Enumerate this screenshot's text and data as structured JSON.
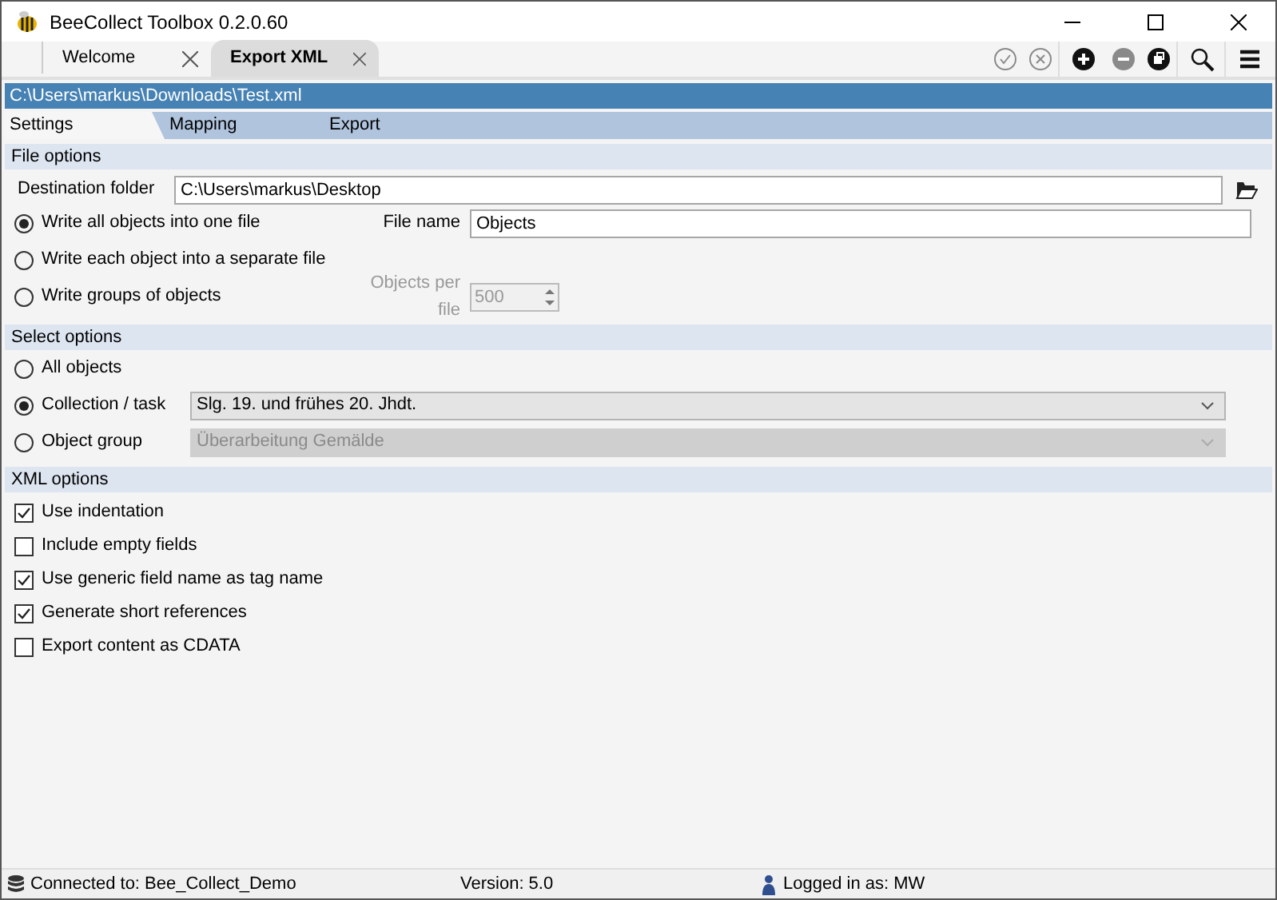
{
  "window": {
    "title": "BeeCollect Toolbox 0.2.0.60"
  },
  "tabs": [
    {
      "label": "Welcome",
      "selected": false
    },
    {
      "label": "Export XML",
      "selected": true
    }
  ],
  "toolbar": [
    {
      "kind": "confirm",
      "disabled": true
    },
    {
      "kind": "cancel",
      "disabled": true
    },
    {
      "kind": "add",
      "disabled": false
    },
    {
      "kind": "remove",
      "disabled": true
    },
    {
      "kind": "copy",
      "disabled": false
    },
    {
      "kind": "search",
      "disabled": false
    },
    {
      "kind": "menu",
      "disabled": false
    }
  ],
  "file_path": "C:\\Users\\markus\\Downloads\\Test.xml",
  "subtabs": [
    {
      "label": "Settings",
      "selected": true
    },
    {
      "label": "Mapping",
      "selected": false
    },
    {
      "label": "Export",
      "selected": false
    }
  ],
  "file_options": {
    "header": "File options",
    "destination_label": "Destination folder",
    "destination_value": "C:\\Users\\markus\\Desktop",
    "modes": [
      {
        "label": "Write all objects into one file",
        "selected": true
      },
      {
        "label": "Write each object into a separate file",
        "selected": false
      },
      {
        "label": "Write groups of objects",
        "selected": false
      }
    ],
    "file_name_label": "File name",
    "file_name_value": "Objects",
    "objects_per_file_label": "Objects per file",
    "objects_per_file_value": "500",
    "objects_per_file_disabled": true
  },
  "select_options": {
    "header": "Select options",
    "items": [
      {
        "kind": "plain",
        "label": "All objects",
        "selected": false
      },
      {
        "kind": "dropdown",
        "label": "Collection / task",
        "selected": true,
        "value": "Slg. 19. und frühes 20. Jhdt.",
        "disabled": false
      },
      {
        "kind": "dropdown",
        "label": "Object group",
        "selected": false,
        "value": "Überarbeitung Gemälde",
        "disabled": true
      }
    ]
  },
  "xml_options": {
    "header": "XML options",
    "items": [
      {
        "label": "Use indentation",
        "checked": true
      },
      {
        "label": "Include empty fields",
        "checked": false
      },
      {
        "label": "Use generic field name as tag name",
        "checked": true
      },
      {
        "label": "Generate short references",
        "checked": true
      },
      {
        "label": "Export content as CDATA",
        "checked": false
      }
    ]
  },
  "status_bar": {
    "connection": "Connected to: Bee_Collect_Demo",
    "version": "Version: 5.0",
    "user": "Logged in as: MW"
  }
}
